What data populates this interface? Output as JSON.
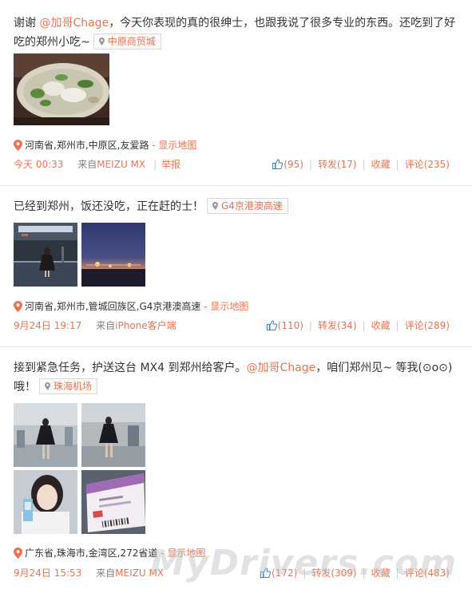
{
  "posts": [
    {
      "text_before": "谢谢 ",
      "mention": "@加哥Chage",
      "text_after": "，今天你表现的真的很绅士，也跟我说了很多专业的东西。还吃到了好吃的郑州小吃~",
      "place_tag": "中原商贸城",
      "location": "河南省,郑州市,中原区,友爱路",
      "map_link": "- 显示地图",
      "time": "今天 00:33",
      "source_prefix": "来自",
      "source": "MEIZU MX",
      "report": "举报",
      "likes": "(95)",
      "repost": "转发(17)",
      "favorite": "收藏",
      "comment": "评论(235)"
    },
    {
      "text": "已经到郑州，饭还没吃，正在赶的士！",
      "place_tag": "G4京港澳高速",
      "location": "河南省,郑州市,管城回族区,G4京港澳高速",
      "map_link": "- 显示地图",
      "time": "9月24日 19:17",
      "source_prefix": "来自",
      "source": "iPhone客户端",
      "likes": "(110)",
      "repost": "转发(34)",
      "favorite": "收藏",
      "comment": "评论(289)"
    },
    {
      "text_before": "接到紧急任务，护送这台 MX4 到郑州给客户。",
      "mention": "@加哥Chage",
      "text_after": "，咱们郑州见~ 等我(⊙o⊙)哦！",
      "place_tag": "珠海机场",
      "location": "广东省,珠海市,金湾区,272省道",
      "map_link": "- 显示地图",
      "time": "9月24日 15:53",
      "source_prefix": "来自",
      "source": "MEIZU MX",
      "likes": "(172)",
      "repost": "转发(309)",
      "favorite": "收藏",
      "comment": "评论(483)"
    }
  ],
  "watermark": "MyDrivers.com",
  "colors": {
    "accent": "#eb7350",
    "text": "#333333",
    "muted": "#808080",
    "divider": "#e6e6e6"
  }
}
